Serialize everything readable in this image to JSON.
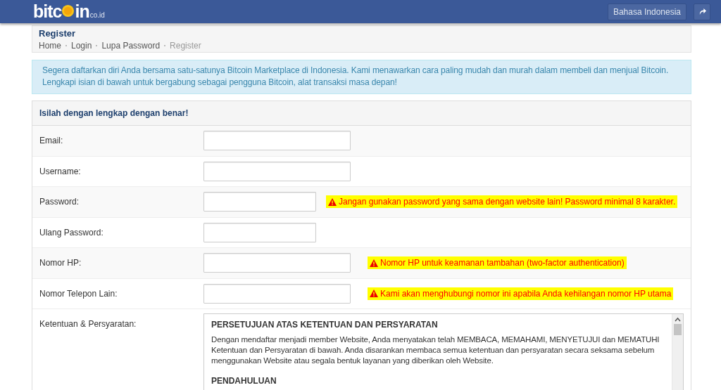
{
  "header": {
    "logo": {
      "start": "bitc",
      "end": "in",
      "suffix": "co.id"
    },
    "language_button": "Bahasa Indonesia"
  },
  "page": {
    "title": "Register",
    "breadcrumb": [
      {
        "label": "Home",
        "current": false
      },
      {
        "label": "Login",
        "current": false
      },
      {
        "label": "Lupa Password",
        "current": false
      },
      {
        "label": "Register",
        "current": true
      }
    ]
  },
  "info": "Segera daftarkan diri Anda bersama satu-satunya Bitcoin Marketplace di Indonesia. Kami menawarkan cara paling mudah dan murah dalam membeli dan menjual Bitcoin. Lengkapi isian di bawah untuk bergabung sebagai pengguna Bitcoin, alat transaksi masa depan!",
  "form": {
    "heading": "Isilah dengan lengkap dengan benar!",
    "fields": [
      {
        "label": "Email:",
        "kind": "wide"
      },
      {
        "label": "Username:",
        "kind": "wide"
      },
      {
        "label": "Password:",
        "kind": "narrow",
        "warning": "Jangan gunakan password yang sama dengan website lain! Password minimal 8 karakter."
      },
      {
        "label": "Ulang Password:",
        "kind": "narrow"
      },
      {
        "label": "Nomor HP:",
        "kind": "wide",
        "warning": "Nomor HP untuk keamanan tambahan (two-factor authentication)"
      },
      {
        "label": "Nomor Telepon Lain:",
        "kind": "wide",
        "warning": "Kami akan menghubungi nomor ini apabila Anda kehilangan nomor HP utama"
      }
    ],
    "terms": {
      "label": "Ketentuan & Persyaratan:",
      "heading": "PERSETUJUAN ATAS KETENTUAN DAN PERSYARATAN",
      "paragraph": "Dengan mendaftar menjadi member Website, Anda menyatakan telah MEMBACA, MEMAHAMI, MENYETUJUI dan MEMATUHI Ketentuan dan Persyaratan di bawah. Anda disarankan membaca semua ketentuan dan persyaratan secara seksama sebelum menggunakan Website atau segala bentuk layanan yang diberikan oleh Website.",
      "next_heading": "PENDAHULUAN"
    }
  }
}
